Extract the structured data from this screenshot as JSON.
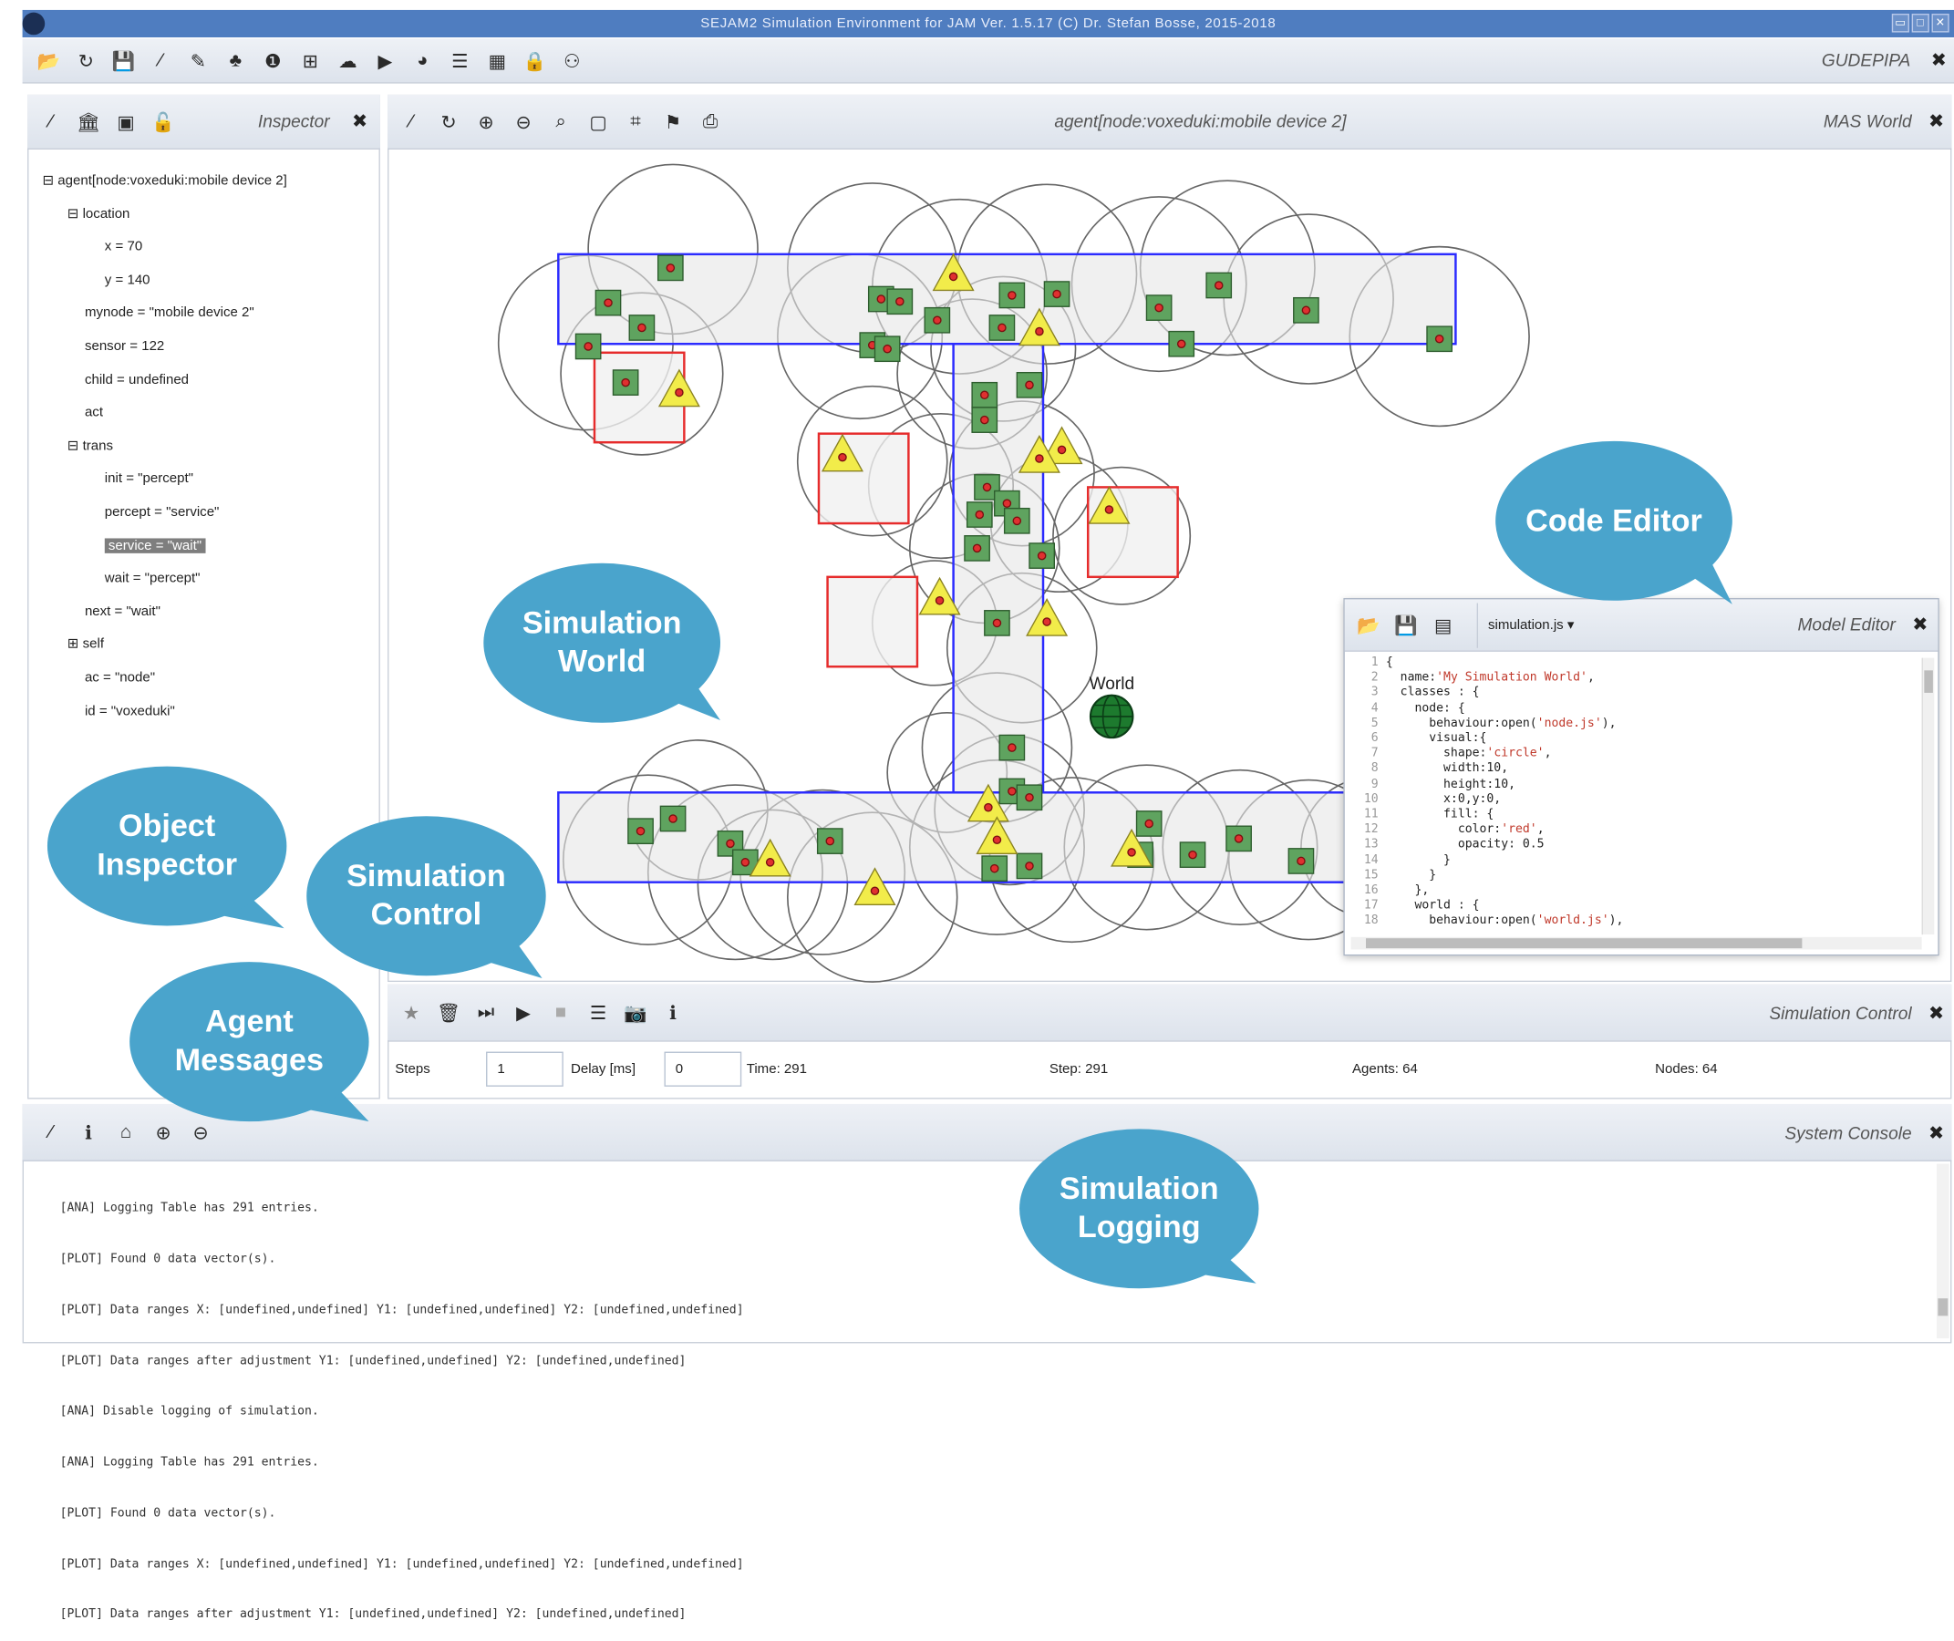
{
  "window": {
    "title": "SEJAM2 Simulation Environment for JAM Ver. 1.5.17 (C) Dr. Stefan Bosse, 2015-2018"
  },
  "main_toolbar": {
    "project_name": "GUDEPIPA"
  },
  "inspector": {
    "title": "Inspector",
    "tree": [
      "agent[node:voxeduki:mobile device 2]",
      "location",
      "x = 70",
      "y = 140",
      "mynode = \"mobile device 2\"",
      "sensor = 122",
      "child = undefined",
      "act",
      "trans",
      "init = \"percept\"",
      "percept = \"service\"",
      "service = \"wait\"",
      "wait = \"percept\"",
      "next = \"wait\"",
      "self",
      "ac = \"node\"",
      "id = \"voxeduki\""
    ]
  },
  "world": {
    "title": "agent[node:voxeduki:mobile device 2]",
    "panel_name": "MAS World",
    "globe_label": "World"
  },
  "editor": {
    "file": "simulation.js ▾",
    "title": "Model Editor",
    "lines": [
      "1",
      "2",
      "3",
      "4",
      "5",
      "6",
      "7",
      "8",
      "9",
      "10",
      "11",
      "12",
      "13",
      "14",
      "15",
      "16",
      "17",
      "18"
    ],
    "code": [
      "{",
      "  name:'My Simulation World',",
      "  classes : {",
      "    node: {",
      "      behaviour:open('node.js'),",
      "      visual:{",
      "        shape:'circle',",
      "        width:10,",
      "        height:10,",
      "        x:0,y:0,",
      "        fill: {",
      "          color:'red',",
      "          opacity: 0.5",
      "        }",
      "      }",
      "    },",
      "    world : {",
      "      behaviour:open('world.js'),"
    ]
  },
  "control": {
    "title": "Simulation Control",
    "steps_label": "Steps",
    "steps_value": "1",
    "delay_label": "Delay [ms]",
    "delay_value": "0",
    "time": "Time: 291",
    "step": "Step: 291",
    "agents": "Agents: 64",
    "nodes": "Nodes: 64"
  },
  "console": {
    "title": "System Console",
    "lines": [
      "[ANA] Logging Table has 291 entries.",
      "[PLOT] Found 0 data vector(s).",
      "[PLOT] Data ranges X: [undefined,undefined] Y1: [undefined,undefined] Y2: [undefined,undefined]",
      "[PLOT] Data ranges after adjustment Y1: [undefined,undefined] Y2: [undefined,undefined]",
      "[ANA] Disable logging of simulation.",
      "[ANA] Logging Table has 291 entries.",
      "[PLOT] Found 0 data vector(s).",
      "[PLOT] Data ranges X: [undefined,undefined] Y1: [undefined,undefined] Y2: [undefined,undefined]",
      "[PLOT] Data ranges after adjustment Y1: [undefined,undefined] Y2: [undefined,undefined]"
    ]
  },
  "callouts": {
    "code_editor": "Code Editor",
    "simulation_world": "Simulation\nWorld",
    "object_inspector": "Object\nInspector",
    "simulation_control": "Simulation\nControl",
    "agent_messages": "Agent\nMessages",
    "simulation_logging": "Simulation\nLogging"
  },
  "colors": {
    "callout": "#4aa4cc",
    "title_bar": "#4f7dc0",
    "agent_fill": "#5fa35f",
    "triangle_fill": "#f2ec4a",
    "corridor": "#2b2bff",
    "zone": "#e62c2c"
  }
}
